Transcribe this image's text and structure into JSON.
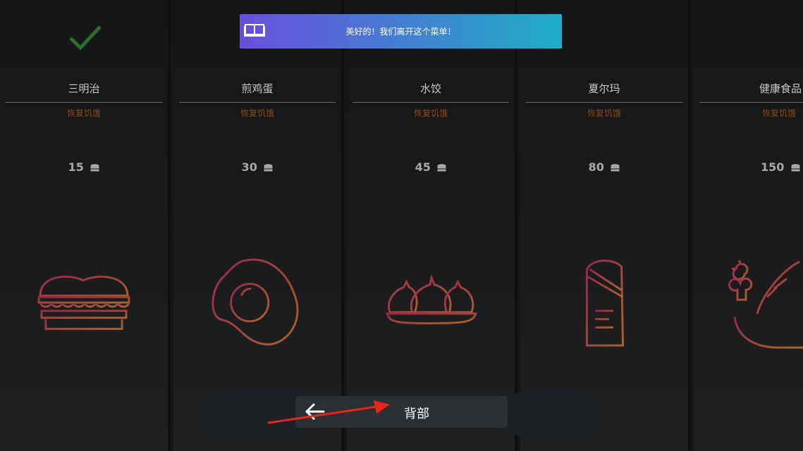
{
  "toast": {
    "message": "美好的！我们离开这个菜单！",
    "icon": "book-icon"
  },
  "menu": {
    "items": [
      {
        "name": "三明治",
        "effect": "恢复饥饿",
        "price": "15",
        "icon": "sandwich-icon",
        "selected": true
      },
      {
        "name": "煎鸡蛋",
        "effect": "恢复饥饿",
        "price": "30",
        "icon": "fried-egg-icon",
        "selected": false
      },
      {
        "name": "水饺",
        "effect": "恢复饥饿",
        "price": "45",
        "icon": "dumplings-icon",
        "selected": false
      },
      {
        "name": "夏尔玛",
        "effect": "恢复饥饿",
        "price": "80",
        "icon": "shawarma-icon",
        "selected": false
      },
      {
        "name": "健康食品",
        "effect": "恢复饥饿",
        "price": "150",
        "icon": "salad-icon",
        "selected": false
      }
    ],
    "currency_icon": "coins-icon"
  },
  "back_button": {
    "label": "背部",
    "icon": "arrow-left-icon"
  },
  "colors": {
    "toast_start": "#6a4fdc",
    "toast_end": "#1faec8",
    "effect_text": "#8a4a1c",
    "check": "#2f6b2f"
  }
}
